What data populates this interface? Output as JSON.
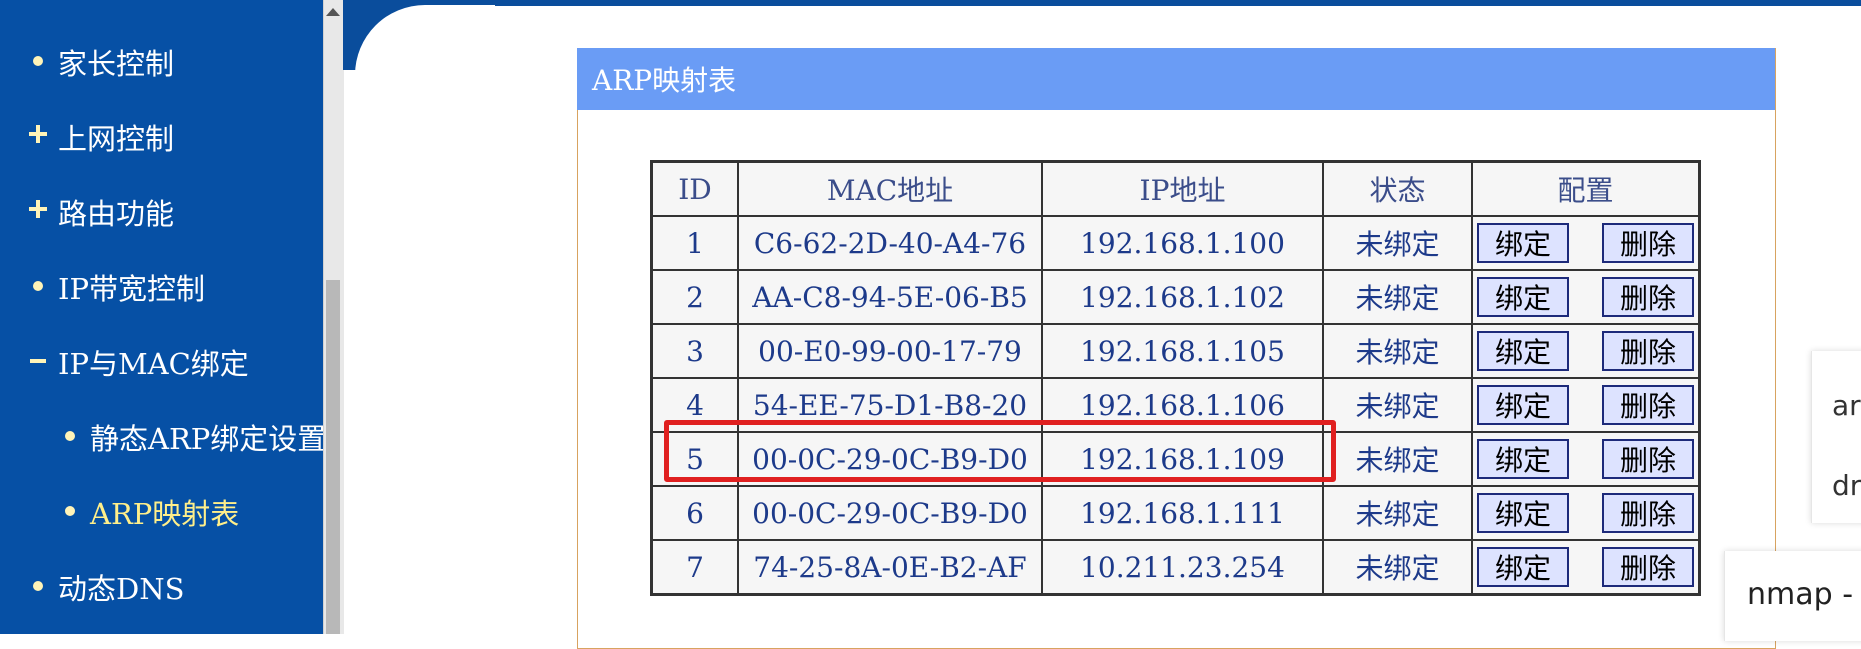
{
  "sidebar": {
    "items": [
      {
        "label": "家长控制",
        "marker": "bullet"
      },
      {
        "label": "上网控制",
        "marker": "plus"
      },
      {
        "label": "路由功能",
        "marker": "plus"
      },
      {
        "label": "IP带宽控制",
        "marker": "bullet"
      },
      {
        "label": "IP与MAC绑定",
        "marker": "minus"
      },
      {
        "label": "静态ARP绑定设置",
        "marker": "bullet"
      },
      {
        "label": "ARP映射表",
        "marker": "bullet",
        "active": true
      },
      {
        "label": "动态DNS",
        "marker": "bullet"
      }
    ]
  },
  "panel": {
    "title": "ARP映射表"
  },
  "table": {
    "headers": [
      "ID",
      "MAC地址",
      "IP地址",
      "状态",
      "配置"
    ],
    "rows": [
      {
        "id": "1",
        "mac": "C6-62-2D-40-A4-76",
        "ip": "192.168.1.100",
        "status": "未绑定"
      },
      {
        "id": "2",
        "mac": "AA-C8-94-5E-06-B5",
        "ip": "192.168.1.102",
        "status": "未绑定"
      },
      {
        "id": "3",
        "mac": "00-E0-99-00-17-79",
        "ip": "192.168.1.105",
        "status": "未绑定"
      },
      {
        "id": "4",
        "mac": "54-EE-75-D1-B8-20",
        "ip": "192.168.1.106",
        "status": "未绑定"
      },
      {
        "id": "5",
        "mac": "00-0C-29-0C-B9-D0",
        "ip": "192.168.1.109",
        "status": "未绑定"
      },
      {
        "id": "6",
        "mac": "00-0C-29-0C-B9-D0",
        "ip": "192.168.1.111",
        "status": "未绑定"
      },
      {
        "id": "7",
        "mac": "74-25-8A-0E-B2-AF",
        "ip": "10.211.23.254",
        "status": "未绑定"
      }
    ],
    "bind_label": "绑定",
    "delete_label": "删除"
  },
  "overlays": {
    "right_line1": "ar",
    "right_line2": "dr",
    "bottom_text": "nmap -"
  },
  "colors": {
    "sidebar_bg": "#0650a5",
    "panel_header_bg": "#6a9cf5",
    "highlight": "#e02020",
    "active_nav": "#ffef8a"
  }
}
